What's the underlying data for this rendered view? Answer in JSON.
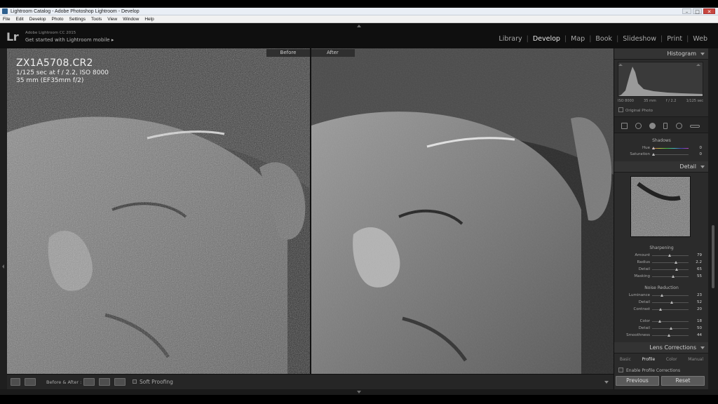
{
  "window": {
    "title": "Lightroom Catalog - Adobe Photoshop Lightroom - Develop",
    "buttons": {
      "minimize": "–",
      "maximize": "□",
      "close": "✕"
    }
  },
  "menubar": [
    "File",
    "Edit",
    "Develop",
    "Photo",
    "Settings",
    "Tools",
    "View",
    "Window",
    "Help"
  ],
  "identity": {
    "logo": "Lr",
    "product": "Adobe Lightroom CC 2015",
    "mobile": "Get started with Lightroom mobile  ▸"
  },
  "modules": [
    "Library",
    "Develop",
    "Map",
    "Book",
    "Slideshow",
    "Print",
    "Web"
  ],
  "active_module": "Develop",
  "view": {
    "before_label": "Before",
    "after_label": "After",
    "filename": "ZX1A5708.CR2",
    "exposure": "1/125 sec at f / 2.2, ISO 8000",
    "lens": "35 mm (EF35mm f/2)"
  },
  "toolbar": {
    "before_after_label": "Before & After :",
    "soft_proofing": "Soft Proofing"
  },
  "histogram": {
    "title": "Histogram",
    "iso": "ISO 8000",
    "focal": "35 mm",
    "aperture": "f / 2.2",
    "shutter": "1/125 sec",
    "original_photo": "Original Photo"
  },
  "split_toning_tail": {
    "shadows": "Shadows",
    "hue_label": "Hue",
    "hue_value": "0",
    "saturation_label": "Saturation",
    "saturation_value": "0"
  },
  "detail": {
    "title": "Detail",
    "sharpening": {
      "title": "Sharpening",
      "amount": {
        "label": "Amount",
        "value": "79",
        "pos": 0.45
      },
      "radius": {
        "label": "Radius",
        "value": "2.2",
        "pos": 0.63
      },
      "detail": {
        "label": "Detail",
        "value": "65",
        "pos": 0.65
      },
      "masking": {
        "label": "Masking",
        "value": "55",
        "pos": 0.55
      }
    },
    "noise_reduction": {
      "title": "Noise Reduction",
      "luminance": {
        "label": "Luminance",
        "value": "23",
        "pos": 0.23
      },
      "lum_detail": {
        "label": "Detail",
        "value": "52",
        "pos": 0.52
      },
      "contrast": {
        "label": "Contrast",
        "value": "20",
        "pos": 0.2
      },
      "color": {
        "label": "Color",
        "value": "18",
        "pos": 0.18
      },
      "color_detail": {
        "label": "Detail",
        "value": "50",
        "pos": 0.5
      },
      "smoothness": {
        "label": "Smoothness",
        "value": "44",
        "pos": 0.44
      }
    }
  },
  "lens_corrections": {
    "title": "Lens Corrections",
    "tabs": [
      "Basic",
      "Profile",
      "Color",
      "Manual"
    ],
    "active_tab": "Profile",
    "enable_label": "Enable Profile Corrections"
  },
  "buttons": {
    "previous": "Previous",
    "reset": "Reset"
  }
}
